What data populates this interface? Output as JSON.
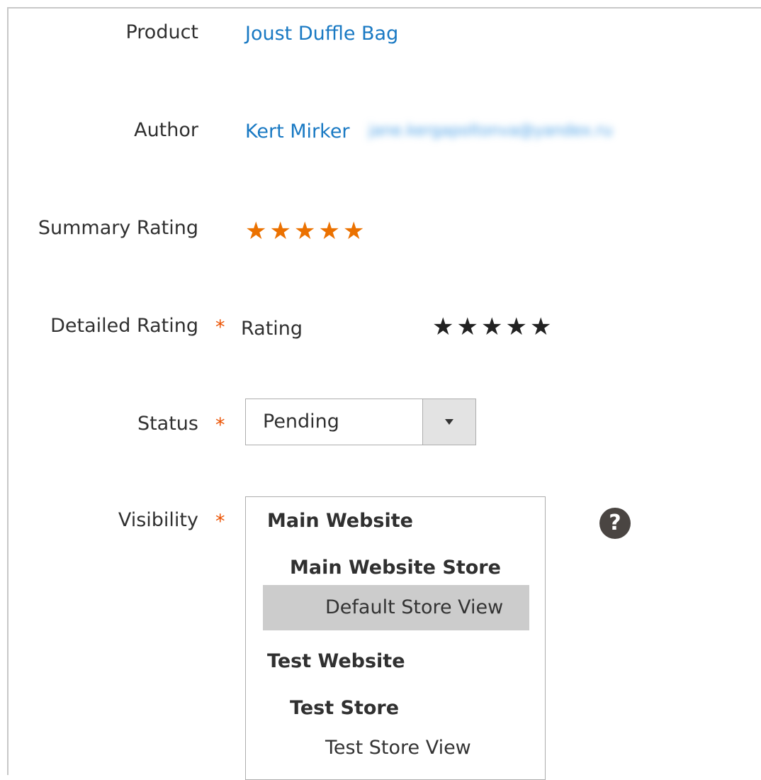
{
  "product": {
    "label": "Product",
    "value": "Joust Duffle Bag"
  },
  "author": {
    "label": "Author",
    "name": "Kert Mirker",
    "email_blurred": "jane.kergapoltonva@yandex.ru"
  },
  "summary_rating": {
    "label": "Summary Rating",
    "stars": 5,
    "max": 5,
    "color": "#eb7100"
  },
  "detailed_rating": {
    "label": "Detailed Rating",
    "required": "*",
    "rating_label": "Rating",
    "stars": 5,
    "max": 5
  },
  "status": {
    "label": "Status",
    "required": "*",
    "value": "Pending"
  },
  "visibility": {
    "label": "Visibility",
    "required": "*",
    "options": [
      {
        "text": "Main Website",
        "kind": "website"
      },
      {
        "text": "Main Website Store",
        "kind": "store"
      },
      {
        "text": "Default Store View",
        "kind": "view",
        "selected": true
      },
      {
        "text": "Test Website",
        "kind": "website"
      },
      {
        "text": "Test Store",
        "kind": "store"
      },
      {
        "text": "Test Store View",
        "kind": "view"
      }
    ],
    "help": "?"
  },
  "colors": {
    "link": "#1979c3",
    "required": "#eb5202",
    "star_orange": "#eb7100",
    "selected_bg": "#cccccc"
  }
}
